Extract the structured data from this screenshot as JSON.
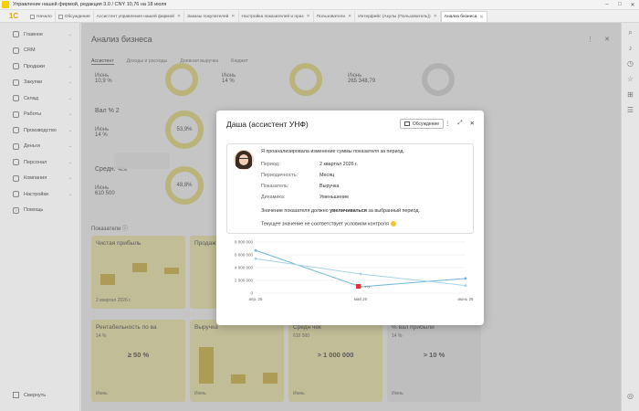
{
  "window": {
    "title": "Управление нашей фирмой, редакция 3.0 / CNY 10,76 на 18 июля"
  },
  "brand": "1С",
  "tabs": [
    {
      "label": "Начало"
    },
    {
      "label": "Обсуждения"
    },
    {
      "label": "Ассистент управления нашей фирмой"
    },
    {
      "label": "Заказы покупателей"
    },
    {
      "label": "Настройка показателей и праз"
    },
    {
      "label": "Пользователи"
    },
    {
      "label": "Интерфейс (Акулы (Пользователь))"
    },
    {
      "label": "Анализ бизнеса"
    }
  ],
  "sidebar": {
    "items": [
      {
        "label": "Главное"
      },
      {
        "label": "CRM"
      },
      {
        "label": "Продажи"
      },
      {
        "label": "Закупки"
      },
      {
        "label": "Склад"
      },
      {
        "label": "Работы"
      },
      {
        "label": "Производство"
      },
      {
        "label": "Деньги"
      },
      {
        "label": "Персонал"
      },
      {
        "label": "Компания"
      },
      {
        "label": "Настройки"
      },
      {
        "label": "Помощь"
      }
    ],
    "collapse": "Свернуть"
  },
  "main": {
    "title": "Анализ бизнеса",
    "subtabs": [
      "Ассистент",
      "Доходы и расходы",
      "Дневная выручка",
      "Бюджет"
    ],
    "kpis": {
      "k1_lbl": "Июнь",
      "k1_val": "10,9 %",
      "k2_lbl": "Июнь",
      "k2_val": "14 %",
      "k3_lbl": "Июнь",
      "k3_val": "265 348,79",
      "vp_title": "Вал % 2",
      "vp_lbl": "Июнь",
      "vp_val": "14 %",
      "vp_ring": "53,9%",
      "sc_title": "Средн. чек",
      "sc_lbl": "Июнь",
      "sc_val": "610 500",
      "sc_ring": "48,8%"
    },
    "section": "Показатели",
    "cards": [
      {
        "title": "Чистая прибыль",
        "foot": "2 квартал 2026 г."
      },
      {
        "title": "Продаж"
      },
      {
        "title": "Рентабельность по ва",
        "sub": "14 %",
        "metric": "≥ 50 %",
        "foot": "Июнь"
      },
      {
        "title": "Выручка",
        "foot": "Июнь"
      },
      {
        "title": "Средн чек",
        "sub": "610 500",
        "metric": "> 1 000 000",
        "foot": "Июнь"
      },
      {
        "title": "% вал прибыли",
        "sub": "14 %",
        "metric": "> 10 %",
        "foot": "Июнь"
      }
    ]
  },
  "dialog": {
    "title": "Даша (ассистент УНФ)",
    "discuss": "Обсуждение",
    "intro": "Я проанализировала изменение суммы показателя за период.",
    "rows": [
      {
        "k": "Период:",
        "v": "2 квартал 2026 г."
      },
      {
        "k": "Периодичность:",
        "v": "Месяц"
      },
      {
        "k": "Показатель:",
        "v": "Выручка"
      },
      {
        "k": "Динамика:",
        "v": "Уменьшение"
      }
    ],
    "note1_a": "Значение показателя должно ",
    "note1_b": "увеличиваться",
    "note1_c": " за выбранный период.",
    "note2": "Текущее значение не соответствует условиям контроля"
  },
  "chart_data": {
    "type": "line",
    "x": [
      "апр. 26",
      "май 26",
      "июнь 26"
    ],
    "ylim": [
      0,
      8000000
    ],
    "y_ticks": [
      "8 000 000",
      "6 000 000",
      "4 000 000",
      "2 000 000",
      "0"
    ],
    "series": [
      {
        "values": [
          6700000,
          1000000,
          2300000
        ],
        "color": "#6fb6d8"
      },
      {
        "values": [
          5400000,
          3000000,
          1200000
        ],
        "color": "#a9d3e8"
      }
    ],
    "marker_label": "+ 0"
  },
  "colors": {
    "accent": "#f5d000",
    "line1": "#6fb6d8",
    "line2": "#a9d3e8"
  }
}
